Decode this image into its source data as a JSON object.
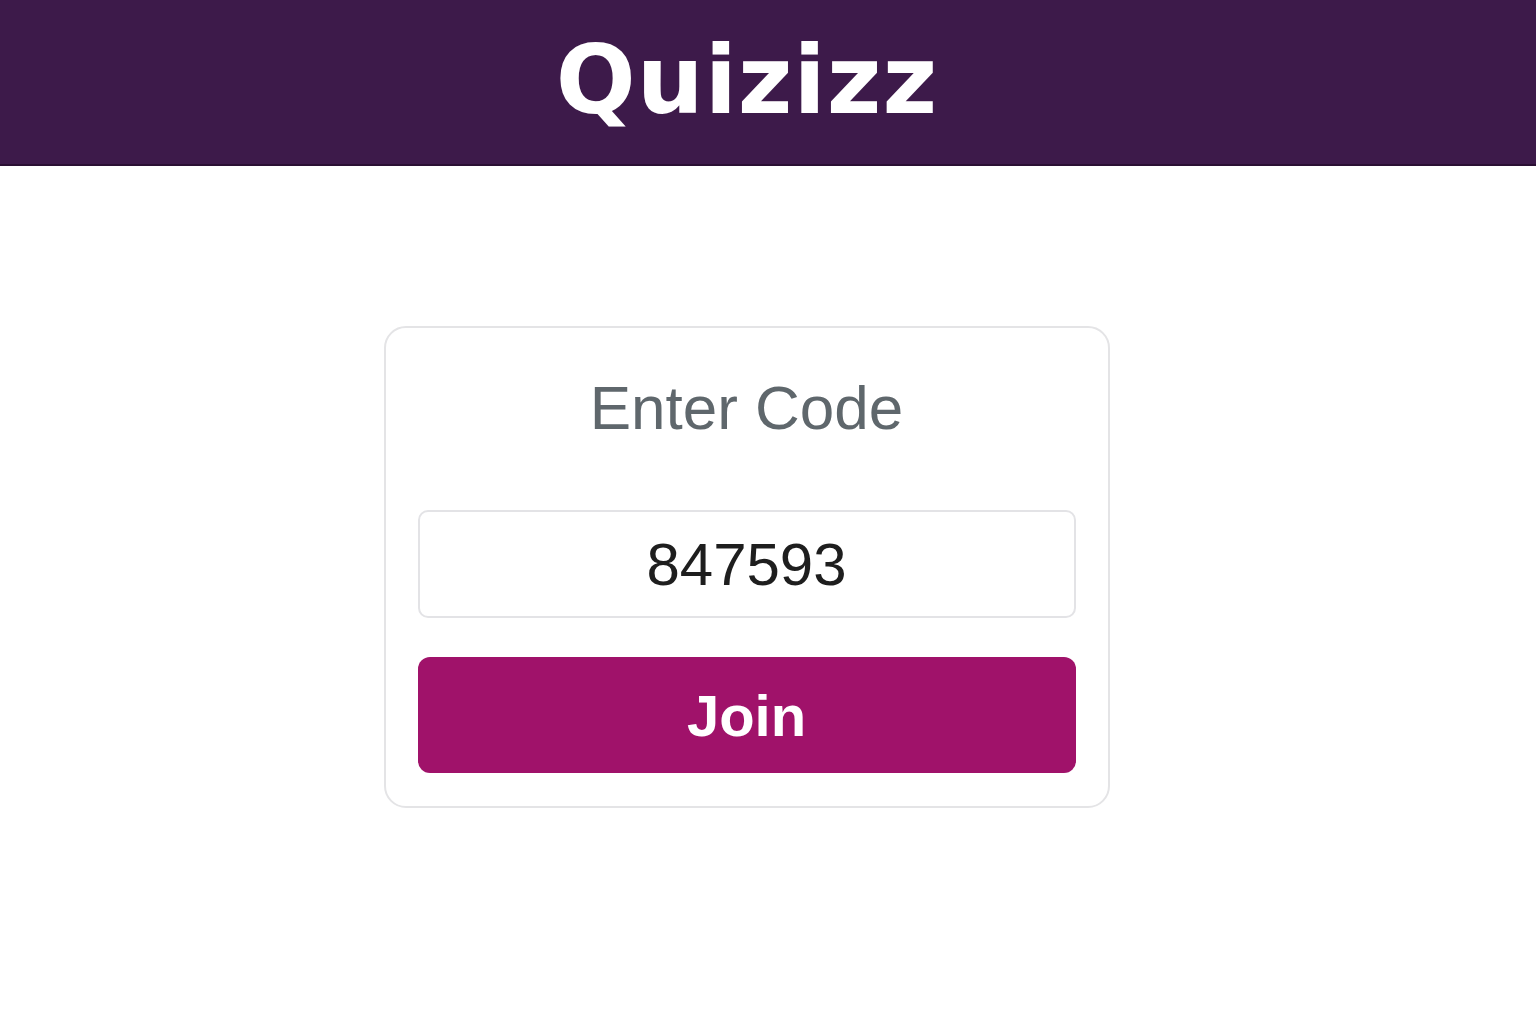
{
  "header": {
    "logo": "Quizizz"
  },
  "join_card": {
    "title": "Enter Code",
    "code_field": {
      "value": "847593"
    },
    "join_button": {
      "label": "Join"
    }
  }
}
